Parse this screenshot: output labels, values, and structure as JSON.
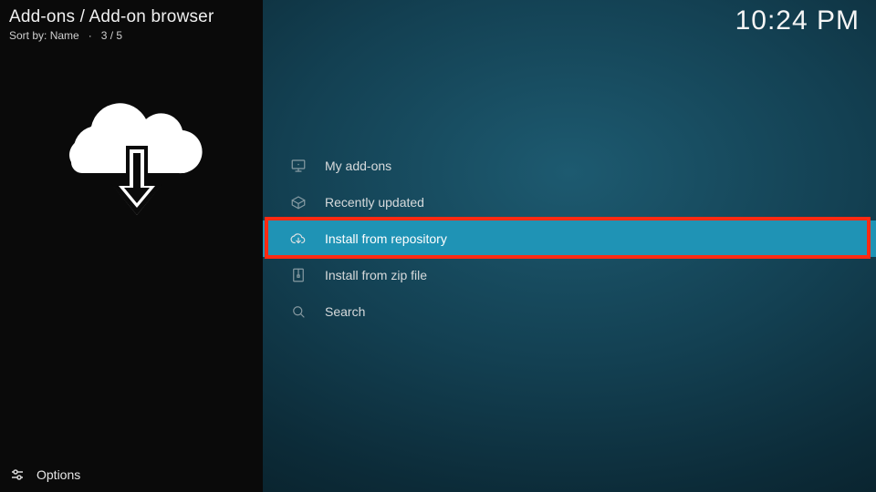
{
  "header": {
    "breadcrumb": "Add-ons / Add-on browser",
    "sort_prefix": "Sort by:",
    "sort_value": "Name",
    "position": "3 / 5"
  },
  "clock": "10:24 PM",
  "menu": {
    "items": [
      {
        "icon": "monitor-icon",
        "label": "My add-ons"
      },
      {
        "icon": "box-open-icon",
        "label": "Recently updated"
      },
      {
        "icon": "cloud-down-icon",
        "label": "Install from repository",
        "selected": true,
        "highlighted": true
      },
      {
        "icon": "zip-file-icon",
        "label": "Install from zip file"
      },
      {
        "icon": "search-icon",
        "label": "Search"
      }
    ]
  },
  "footer": {
    "options_label": "Options"
  }
}
